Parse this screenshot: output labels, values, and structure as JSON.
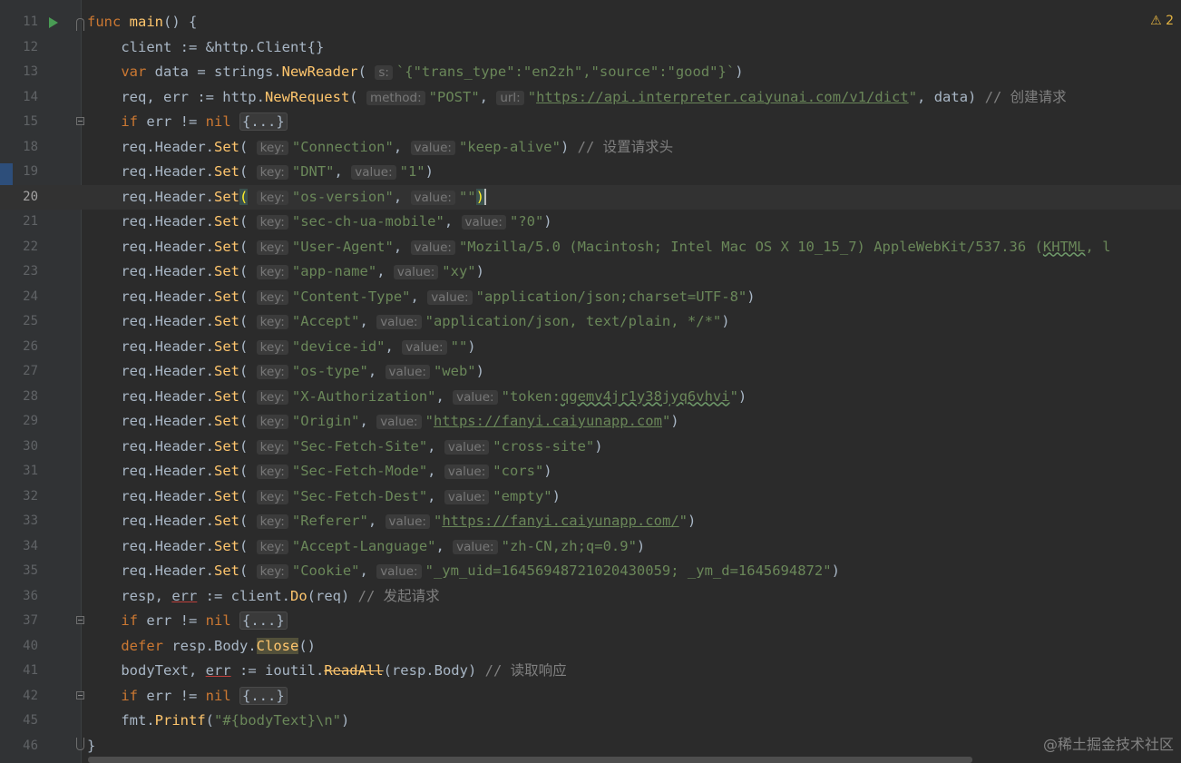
{
  "warning_badge": {
    "icon": "warning-icon",
    "text": "2"
  },
  "watermark": "@稀土掘金技术社区",
  "code_lines": [
    {
      "n": "11",
      "html": "<span class='kw'>func</span> <span class='fn'>main</span>() {"
    },
    {
      "n": "12",
      "html": "    client := &amp;http.<span style='color:#a9b7c6'>Client</span>{}"
    },
    {
      "n": "13",
      "html": "    <span class='kw'>var</span> data = strings.<span class='fn'>NewReader</span>( <span class='hint'>s:</span><span class='str'>`{\"trans_type\":\"en2zh\",\"source\":\"good\"}`</span>)"
    },
    {
      "n": "14",
      "html": "    req, err := http.<span class='fn'>NewRequest</span>( <span class='hint'>method:</span><span class='str'>\"POST\"</span>, <span class='hint'>url:</span><span class='str'>\"<span class='url'>https://api.interpreter.caiyunai.com/v1/dict</span>\"</span>, data) <span class='cmt'>// 创建请求</span>"
    },
    {
      "n": "15",
      "html": "    <span class='kw'>if</span> err != <span class='kw'>nil</span> <span class='fold'>{...}</span>"
    },
    {
      "n": "18",
      "html": "    req.Header.<span class='fn'>Set</span>( <span class='hint'>key:</span><span class='str'>\"Connection\"</span>, <span class='hint'>value:</span><span class='str'>\"keep-alive\"</span>) <span class='cmt'>// 设置请求头</span>"
    },
    {
      "n": "19",
      "html": "    req.Header.<span class='fn'>Set</span>( <span class='hint'>key:</span><span class='str'>\"DNT\"</span>, <span class='hint'>value:</span><span class='str'>\"1\"</span>)"
    },
    {
      "n": "20",
      "html": "    req.Header.<span class='fn'>Set</span><span class='bracket'>(</span> <span class='hint'>key:</span><span class='str'>\"os-version\"</span>, <span class='hint'>value:</span><span class='str'>\"\"</span><span class='bracket'>)</span><span class='caret'></span>"
    },
    {
      "n": "21",
      "html": "    req.Header.<span class='fn'>Set</span>( <span class='hint'>key:</span><span class='str'>\"sec-ch-ua-mobile\"</span>, <span class='hint'>value:</span><span class='str'>\"?0\"</span>)"
    },
    {
      "n": "22",
      "html": "    req.Header.<span class='fn'>Set</span>( <span class='hint'>key:</span><span class='str'>\"User-Agent\"</span>, <span class='hint'>value:</span><span class='str'>\"Mozilla/5.0 (Macintosh; Intel Mac OS X 10_15_7) AppleWebKit/537.36 (<span class='wavy'>KHTML</span>, l</span>"
    },
    {
      "n": "23",
      "html": "    req.Header.<span class='fn'>Set</span>( <span class='hint'>key:</span><span class='str'>\"app-name\"</span>, <span class='hint'>value:</span><span class='str'>\"xy\"</span>)"
    },
    {
      "n": "24",
      "html": "    req.Header.<span class='fn'>Set</span>( <span class='hint'>key:</span><span class='str'>\"Content-Type\"</span>, <span class='hint'>value:</span><span class='str'>\"application/json;charset=UTF-8\"</span>)"
    },
    {
      "n": "25",
      "html": "    req.Header.<span class='fn'>Set</span>( <span class='hint'>key:</span><span class='str'>\"Accept\"</span>, <span class='hint'>value:</span><span class='str'>\"application/json, text/plain, */*\"</span>)"
    },
    {
      "n": "26",
      "html": "    req.Header.<span class='fn'>Set</span>( <span class='hint'>key:</span><span class='str'>\"device-id\"</span>, <span class='hint'>value:</span><span class='str'>\"\"</span>)"
    },
    {
      "n": "27",
      "html": "    req.Header.<span class='fn'>Set</span>( <span class='hint'>key:</span><span class='str'>\"os-type\"</span>, <span class='hint'>value:</span><span class='str'>\"web\"</span>)"
    },
    {
      "n": "28",
      "html": "    req.Header.<span class='fn'>Set</span>( <span class='hint'>key:</span><span class='str'>\"X-Authorization\"</span>, <span class='hint'>value:</span><span class='str'>\"token:<span class='wavy'>qgemv4jr1y38jyq6vhvi</span>\"</span>)"
    },
    {
      "n": "29",
      "html": "    req.Header.<span class='fn'>Set</span>( <span class='hint'>key:</span><span class='str'>\"Origin\"</span>, <span class='hint'>value:</span><span class='str'>\"<span class='url'>https://fanyi.caiyunapp.com</span>\"</span>)"
    },
    {
      "n": "30",
      "html": "    req.Header.<span class='fn'>Set</span>( <span class='hint'>key:</span><span class='str'>\"Sec-Fetch-Site\"</span>, <span class='hint'>value:</span><span class='str'>\"cross-site\"</span>)"
    },
    {
      "n": "31",
      "html": "    req.Header.<span class='fn'>Set</span>( <span class='hint'>key:</span><span class='str'>\"Sec-Fetch-Mode\"</span>, <span class='hint'>value:</span><span class='str'>\"cors\"</span>)"
    },
    {
      "n": "32",
      "html": "    req.Header.<span class='fn'>Set</span>( <span class='hint'>key:</span><span class='str'>\"Sec-Fetch-Dest\"</span>, <span class='hint'>value:</span><span class='str'>\"empty\"</span>)"
    },
    {
      "n": "33",
      "html": "    req.Header.<span class='fn'>Set</span>( <span class='hint'>key:</span><span class='str'>\"Referer\"</span>, <span class='hint'>value:</span><span class='str'>\"<span class='url'>https://fanyi.caiyunapp.com/</span>\"</span>)"
    },
    {
      "n": "34",
      "html": "    req.Header.<span class='fn'>Set</span>( <span class='hint'>key:</span><span class='str'>\"Accept-Language\"</span>, <span class='hint'>value:</span><span class='str'>\"zh-CN,zh;q=0.9\"</span>)"
    },
    {
      "n": "35",
      "html": "    req.Header.<span class='fn'>Set</span>( <span class='hint'>key:</span><span class='str'>\"Cookie\"</span>, <span class='hint'>value:</span><span class='str'>\"_ym_uid=16456948721020430059; _ym_d=1645694872\"</span>)"
    },
    {
      "n": "36",
      "html": "    resp, <span class='ul-red'>err</span> := client.<span class='fn'>Do</span>(req) <span class='cmt'>// 发起请求</span>"
    },
    {
      "n": "37",
      "html": "    <span class='kw'>if</span> err != <span class='kw'>nil</span> <span class='fold'>{...}</span>"
    },
    {
      "n": "40",
      "html": "    <span class='kw'>defer</span> resp.Body.<span class='fn close-hl'>Close</span>()"
    },
    {
      "n": "41",
      "html": "    bodyText, <span class='ul-red'>err</span> := ioutil.<span class='fn strike'>ReadAll</span>(resp.Body) <span class='cmt'>// 读取响应</span>"
    },
    {
      "n": "42",
      "html": "    <span class='kw'>if</span> err != <span class='kw'>nil</span> <span class='fold'>{...}</span>"
    },
    {
      "n": "45",
      "html": "    fmt.<span class='fn'>Printf</span>(<span class='str'>\"#{bodyText}\\n\"</span>)"
    },
    {
      "n": "46",
      "html": "}"
    }
  ],
  "current_line": "20",
  "run_line": "11",
  "fold_lines": [
    "15",
    "37",
    "42"
  ],
  "fold_start_lines": [
    "11"
  ],
  "fold_end_lines": [
    "46"
  ]
}
